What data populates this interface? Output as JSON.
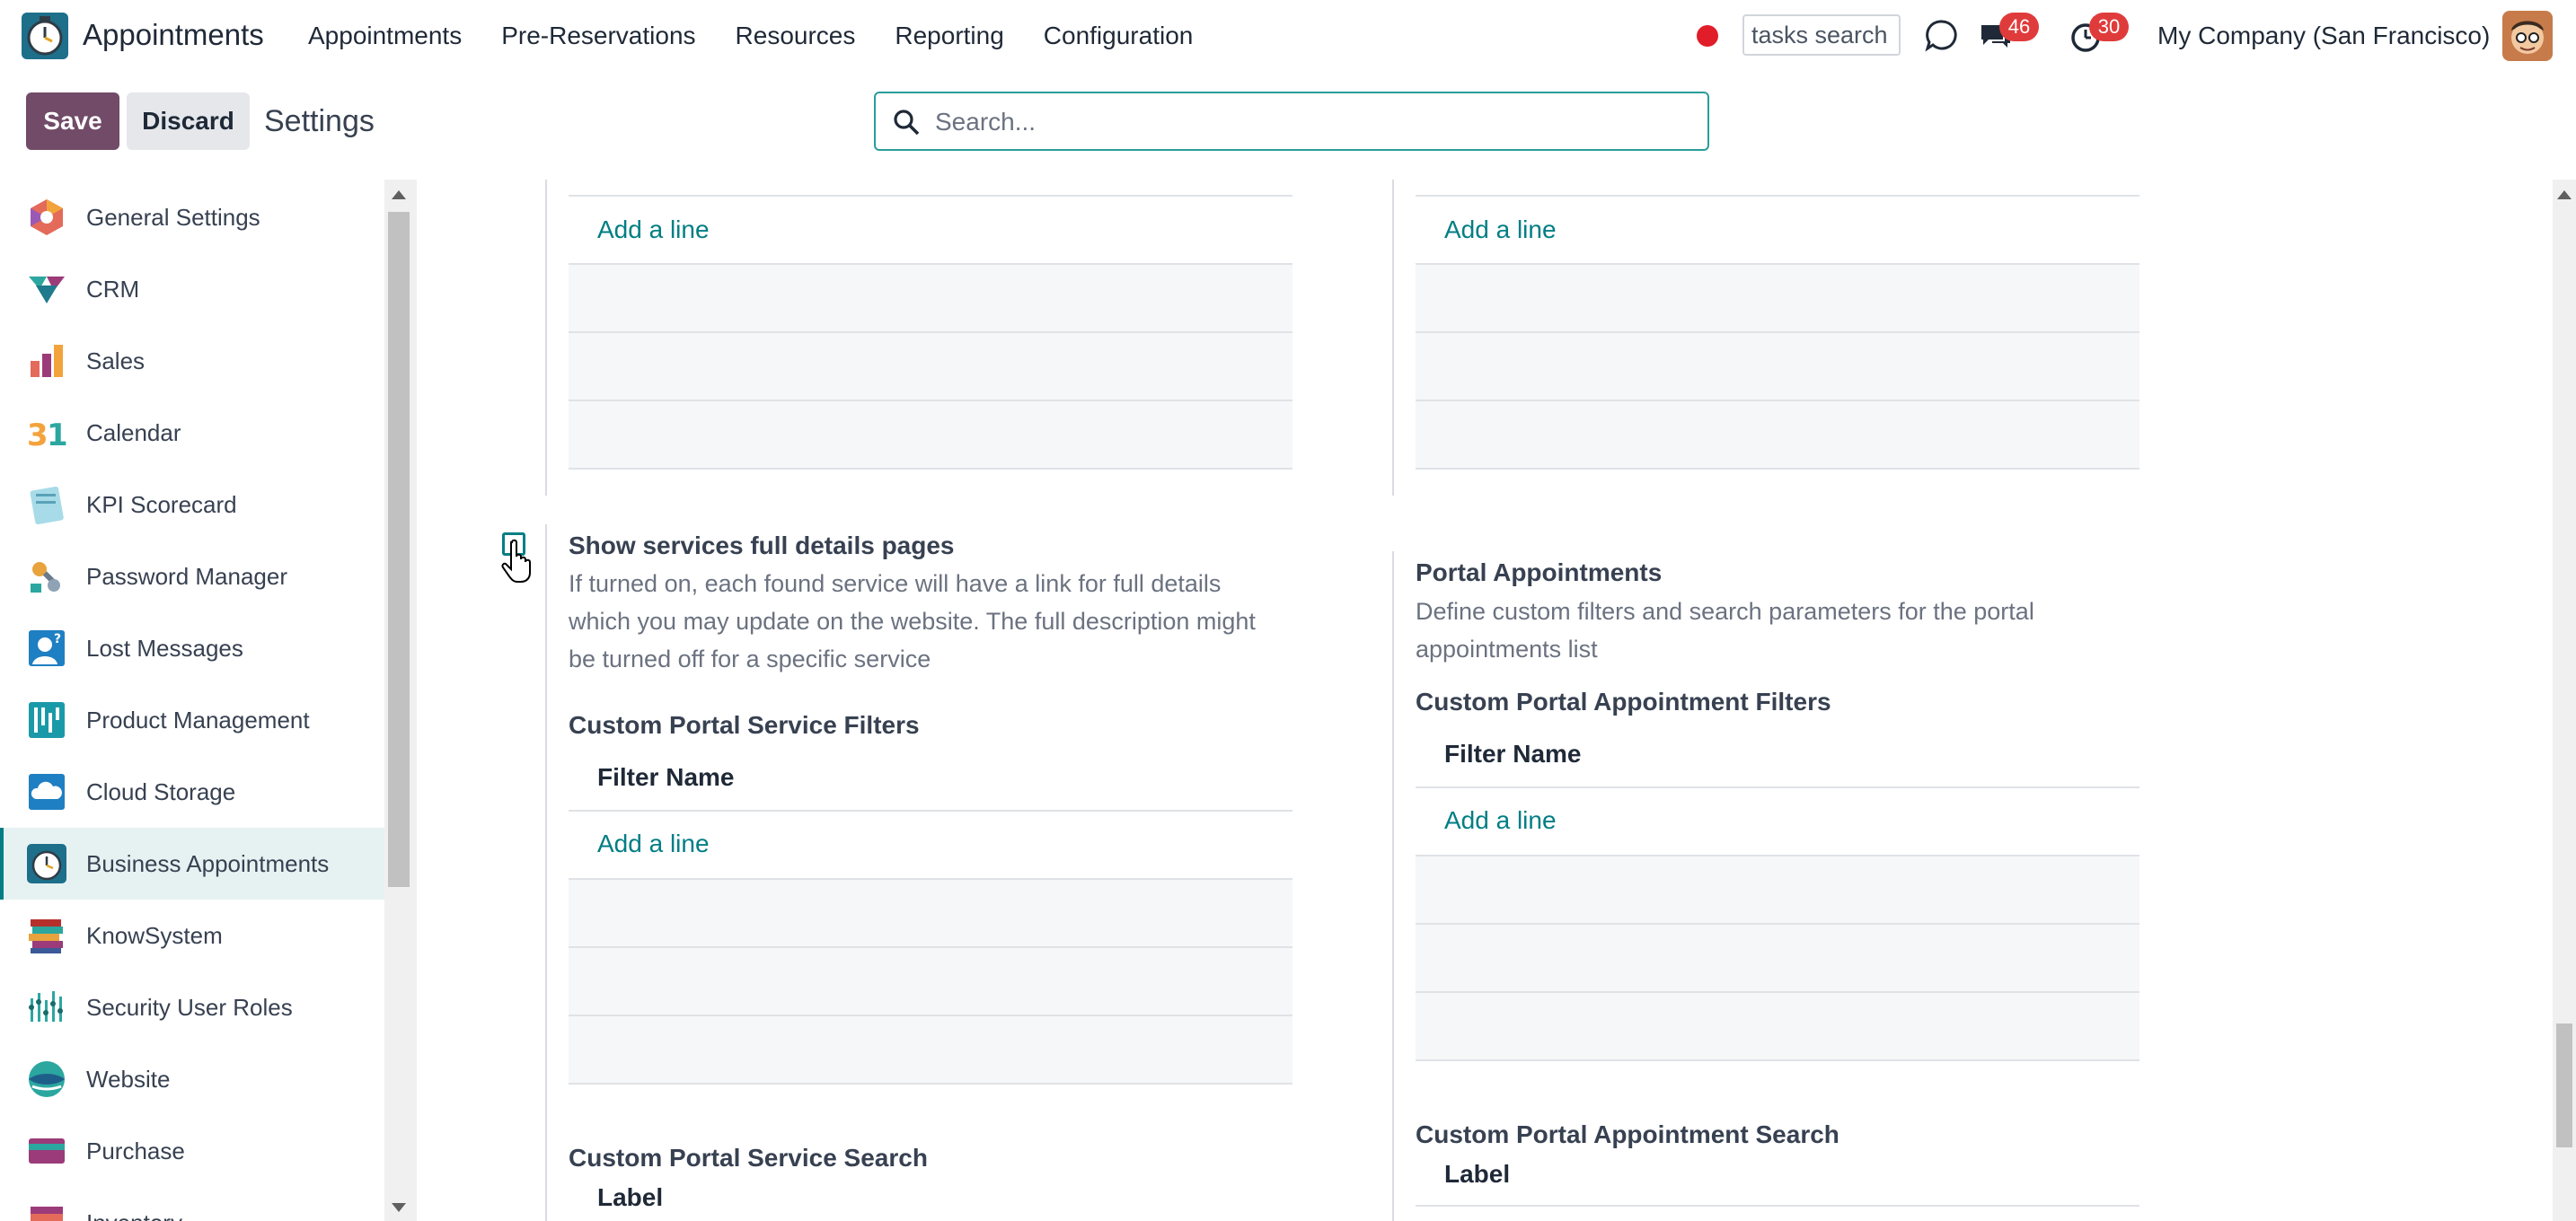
{
  "navbar": {
    "app_name": "Appointments",
    "menu": [
      "Appointments",
      "Pre-Reservations",
      "Resources",
      "Reporting",
      "Configuration"
    ],
    "tasks_search_value": "tasks search",
    "messages_badge": "46",
    "activities_badge": "30",
    "company": "My Company (San Francisco)"
  },
  "control": {
    "save_label": "Save",
    "discard_label": "Discard",
    "title": "Settings",
    "search_placeholder": "Search..."
  },
  "sidebar": {
    "items": [
      {
        "label": "General Settings",
        "icon": "general-settings-icon"
      },
      {
        "label": "CRM",
        "icon": "crm-icon"
      },
      {
        "label": "Sales",
        "icon": "sales-icon"
      },
      {
        "label": "Calendar",
        "icon": "calendar-icon"
      },
      {
        "label": "KPI Scorecard",
        "icon": "kpi-icon"
      },
      {
        "label": "Password Manager",
        "icon": "password-icon"
      },
      {
        "label": "Lost Messages",
        "icon": "lost-messages-icon"
      },
      {
        "label": "Product Management",
        "icon": "product-icon"
      },
      {
        "label": "Cloud Storage",
        "icon": "cloud-icon"
      },
      {
        "label": "Business Appointments",
        "icon": "appointments-icon",
        "active": true
      },
      {
        "label": "KnowSystem",
        "icon": "books-icon"
      },
      {
        "label": "Security User Roles",
        "icon": "security-icon"
      },
      {
        "label": "Website",
        "icon": "website-icon"
      },
      {
        "label": "Purchase",
        "icon": "purchase-icon"
      },
      {
        "label": "Inventory",
        "icon": "inventory-icon"
      }
    ]
  },
  "content": {
    "add_line": "Add a line",
    "left": {
      "setting_title": "Show services full details pages",
      "setting_desc_lines": [
        "If turned on, each found service will have a link for full details",
        "which you may update on the website. The full description might",
        "be turned off for a specific service"
      ],
      "filters_title": "Custom Portal Service Filters",
      "filter_col": "Filter Name",
      "search_title": "Custom Portal Service Search",
      "search_col": "Label"
    },
    "right": {
      "setting_title": "Portal Appointments",
      "setting_desc_lines": [
        "Define custom filters and search parameters for the portal",
        "appointments list"
      ],
      "filters_title": "Custom Portal Appointment Filters",
      "filter_col": "Filter Name",
      "search_title": "Custom Portal Appointment Search",
      "search_col": "Label"
    }
  },
  "colors": {
    "brand": "#714b67",
    "link": "#017e84",
    "badge": "#e03b3b"
  }
}
